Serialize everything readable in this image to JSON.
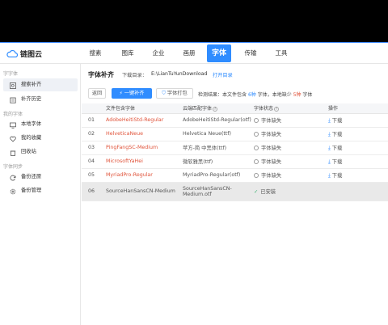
{
  "app": {
    "name": "链图云"
  },
  "nav": [
    {
      "label": "搜素"
    },
    {
      "label": "图库"
    },
    {
      "label": "企业"
    },
    {
      "label": "画册"
    },
    {
      "label": "字体"
    },
    {
      "label": "传输"
    },
    {
      "label": "工具"
    }
  ],
  "sidebar": {
    "group1": "字字体",
    "group2": "我的字体",
    "group3": "字体同步",
    "items": [
      {
        "label": "搜索补齐"
      },
      {
        "label": "补齐历史"
      },
      {
        "label": "本地字体"
      },
      {
        "label": "我的收藏"
      },
      {
        "label": "回收站"
      },
      {
        "label": "备份还原"
      },
      {
        "label": "备份管理"
      }
    ]
  },
  "main": {
    "title": "字体补齐",
    "download_dir_label": "下载目录：",
    "download_dir": "E:\\LianTuYunDownload",
    "open_dir": "打开目录",
    "back": "返回",
    "one_click": "一键补齐",
    "pack": "字体打包",
    "detect": {
      "prefix": "检测结果：本文件包含",
      "count": "6种",
      "middle": "字体，本地缺少",
      "missing": "5种",
      "suffix": "字体"
    },
    "columns": [
      "文件包含字体",
      "云端匹配字体",
      "字体状态",
      "操作"
    ],
    "rows": [
      {
        "num": "01",
        "font": "AdobeHeitiStd-Regular",
        "match": "AdobeHeitiStd-Regular(otf)",
        "status": "字体缺失",
        "op": "下载"
      },
      {
        "num": "02",
        "font": "HelveticaNeue",
        "match": "Helvetica Neue(ttf)",
        "status": "字体缺失",
        "op": "下载"
      },
      {
        "num": "03",
        "font": "PingFangSC-Medium",
        "match": "苹方-简 中黑体(ttf)",
        "status": "字体缺失",
        "op": "下载"
      },
      {
        "num": "04",
        "font": "MicrosoftYaHei",
        "match": "微软雅黑(ttf)",
        "status": "字体缺失",
        "op": "下载"
      },
      {
        "num": "05",
        "font": "MyriadPro-Regular",
        "match": "MyriadPro-Regular(otf)",
        "status": "字体缺失",
        "op": "下载"
      },
      {
        "num": "06",
        "font": "SourceHanSansCN-Medium",
        "match": "SourceHanSansCN-Medium.otf",
        "status": "已安装",
        "op": ""
      }
    ]
  },
  "colors": {
    "accent": "#2f8cff",
    "missing": "#e0533a",
    "installed": "#3cb371"
  }
}
